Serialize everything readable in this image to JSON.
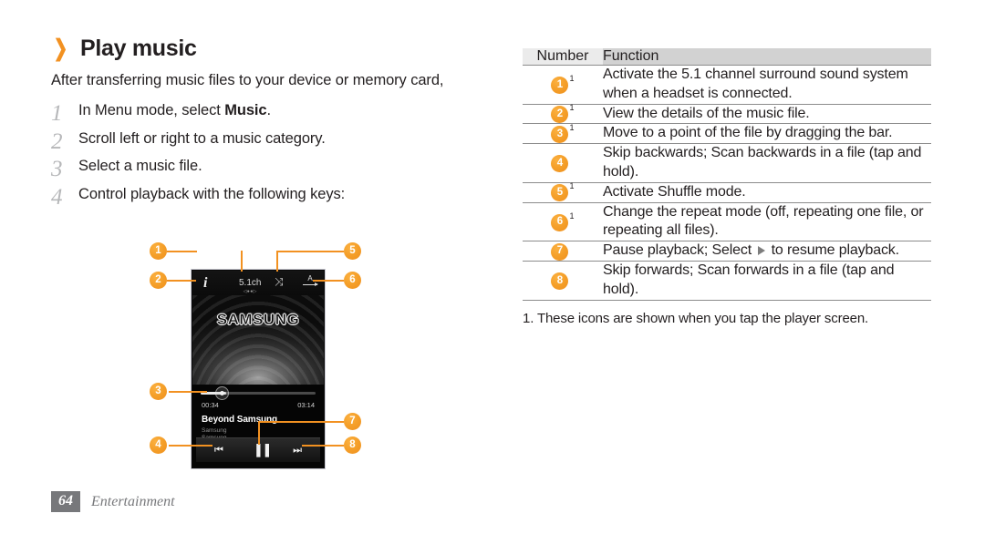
{
  "heading": {
    "chevron": "❯",
    "title": "Play music"
  },
  "intro": "After transferring music files to your device or memory card,",
  "steps": [
    {
      "num": "1",
      "text_before": "In Menu mode, select ",
      "bold": "Music",
      "text_after": "."
    },
    {
      "num": "2",
      "text_before": "Scroll left or right to a music category.",
      "bold": "",
      "text_after": ""
    },
    {
      "num": "3",
      "text_before": "Select a music file.",
      "bold": "",
      "text_after": ""
    },
    {
      "num": "4",
      "text_before": "Control playback with the following keys:",
      "bold": "",
      "text_after": ""
    }
  ],
  "phone": {
    "icons": {
      "info": "i",
      "surround_label": "5.1ch",
      "surround_dots": "◁●●▷",
      "shuffle": "⤨",
      "repeat_letter": "A"
    },
    "album_art_logo": "SAMSUNG",
    "progress_percent": "22",
    "time_current": "00:34",
    "time_total": "03:14",
    "track_title": "Beyond Samsung",
    "track_artist": "Samsung",
    "track_album": "Samsung",
    "controls": {
      "previous": "⏮",
      "pause": "▐▐",
      "next": "⏭"
    }
  },
  "callouts": [
    {
      "id": "1",
      "label": "1"
    },
    {
      "id": "2",
      "label": "2"
    },
    {
      "id": "3",
      "label": "3"
    },
    {
      "id": "4",
      "label": "4"
    },
    {
      "id": "5",
      "label": "5"
    },
    {
      "id": "6",
      "label": "6"
    },
    {
      "id": "7",
      "label": "7"
    },
    {
      "id": "8",
      "label": "8"
    }
  ],
  "table": {
    "headers": {
      "number": "Number",
      "function": "Function"
    },
    "rows": [
      {
        "num": "1",
        "sup": "1",
        "text": "Activate the 5.1 channel surround sound system when a headset is connected."
      },
      {
        "num": "2",
        "sup": "1",
        "text": "View the details of the music file."
      },
      {
        "num": "3",
        "sup": "1",
        "text": "Move to a point of the file by dragging the bar."
      },
      {
        "num": "4",
        "sup": "",
        "text": "Skip backwards; Scan backwards in a file (tap and hold)."
      },
      {
        "num": "5",
        "sup": "1",
        "text": "Activate Shuffle mode."
      },
      {
        "num": "6",
        "sup": "1",
        "text": "Change the repeat mode (off, repeating one file, or repeating all files)."
      },
      {
        "num": "7",
        "sup": "",
        "text_before": "Pause playback; Select ",
        "text_after": " to resume playback."
      },
      {
        "num": "8",
        "sup": "",
        "text": "Skip forwards; Scan forwards in a file (tap and hold)."
      }
    ],
    "note": "1. These icons are shown when you tap the player screen."
  },
  "footer": {
    "page_number": "64",
    "section": "Entertainment"
  },
  "colors": {
    "accent_orange": "#f29121",
    "badge_orange": "#f5a02a",
    "header_num_bg": "#ebebeb",
    "header_fn_bg": "#d2d2d2",
    "rule": "#8c8c8c",
    "footer_gray": "#77787b",
    "step_num_gray": "#b6b7b9"
  }
}
